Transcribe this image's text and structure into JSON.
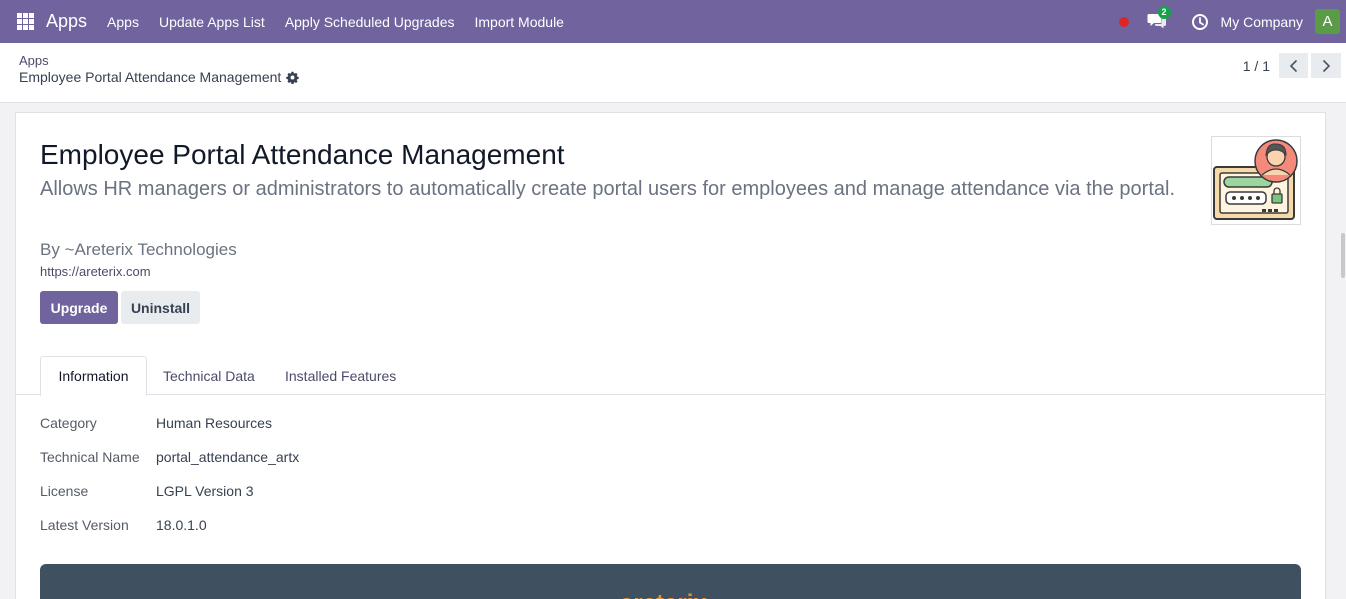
{
  "navbar": {
    "brand": "Apps",
    "items": [
      "Apps",
      "Update Apps List",
      "Apply Scheduled Upgrades",
      "Import Module"
    ],
    "chat_badge": "2",
    "company": "My Company",
    "avatar_letter": "A",
    "bg_color": "#71639e"
  },
  "breadcrumb": {
    "parent": "Apps",
    "current": "Employee Portal Attendance Management"
  },
  "pager": {
    "value": "1 / 1"
  },
  "module": {
    "title": "Employee Portal Attendance Management",
    "summary": "Allows HR managers or administrators to automatically create portal users for employees and manage attendance via the portal.",
    "author": "By ~Areterix Technologies",
    "website": "https://areterix.com",
    "upgrade_label": "Upgrade",
    "uninstall_label": "Uninstall"
  },
  "tabs": [
    "Information",
    "Technical Data",
    "Installed Features"
  ],
  "info": {
    "category_label": "Category",
    "category_value": "Human Resources",
    "technical_name_label": "Technical Name",
    "technical_name_value": "portal_attendance_artx",
    "license_label": "License",
    "license_value": "LGPL Version 3",
    "version_label": "Latest Version",
    "version_value": "18.0.1.0"
  },
  "banner": {
    "logo_text": "areterix"
  }
}
